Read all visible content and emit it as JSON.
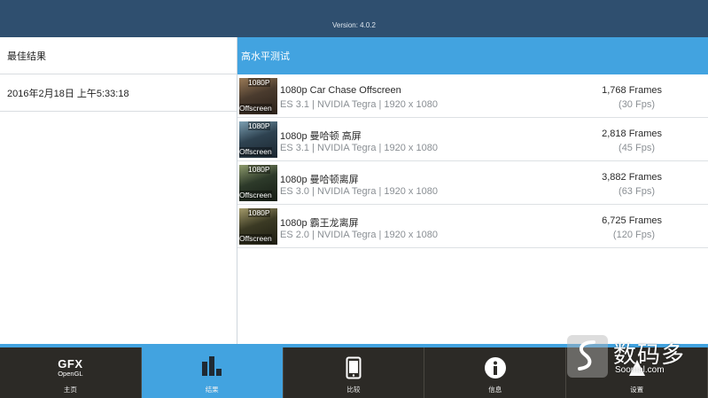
{
  "app": {
    "version": "Version: 4.0.2"
  },
  "left_panel": {
    "heading": "最佳结果",
    "timestamp": "2016年2月18日 上午5:33:18"
  },
  "right_panel": {
    "heading": "高水平测试",
    "tests": [
      {
        "badge": "1080P",
        "sub": "Offscreen",
        "name": "1080p Car Chase Offscreen",
        "meta": "ES 3.1 | NVIDIA Tegra | 1920 x 1080",
        "frames": "1,768 Frames",
        "fps": "(30 Fps)",
        "thumb_colors": [
          "#4a3b2e",
          "#9a7a56",
          "#2b2119"
        ]
      },
      {
        "badge": "1080P",
        "sub": "Offscreen",
        "name": "1080p 曼哈顿 高屏",
        "meta": "ES 3.1 | NVIDIA Tegra | 1920 x 1080",
        "frames": "2,818 Frames",
        "fps": "(45 Fps)",
        "thumb_colors": [
          "#2e4250",
          "#7c9fb2",
          "#1b2630"
        ]
      },
      {
        "badge": "1080P",
        "sub": "Offscreen",
        "name": "1080p 曼哈顿离屏",
        "meta": "ES 3.0 | NVIDIA Tegra | 1920 x 1080",
        "frames": "3,882 Frames",
        "fps": "(63 Fps)",
        "thumb_colors": [
          "#2d3a2a",
          "#8d9a6c",
          "#161d14"
        ]
      },
      {
        "badge": "1080P",
        "sub": "Offscreen",
        "name": "1080p 霸王龙离屏",
        "meta": "ES 2.0 | NVIDIA Tegra | 1920 x 1080",
        "frames": "6,725 Frames",
        "fps": "(120 Fps)",
        "thumb_colors": [
          "#3b3a24",
          "#a39a6a",
          "#1e1d12"
        ]
      }
    ]
  },
  "bottom_nav": {
    "items": [
      {
        "label": "主页",
        "icon": "gfx-opengl-logo",
        "logo_line1": "GFX",
        "logo_line2": "OpenGL"
      },
      {
        "label": "结果",
        "icon": "bar-chart-icon"
      },
      {
        "label": "比较",
        "icon": "phone-icon"
      },
      {
        "label": "信息",
        "icon": "info-icon"
      },
      {
        "label": "设置",
        "icon": "settings-icon"
      }
    ],
    "active_index": 1
  },
  "watermark": {
    "text": "数码多",
    "url": "Soomal.com"
  },
  "colors": {
    "topbar": "#2f4f6f",
    "accent": "#42a3e0",
    "nav_bg": "#2c2a26"
  }
}
